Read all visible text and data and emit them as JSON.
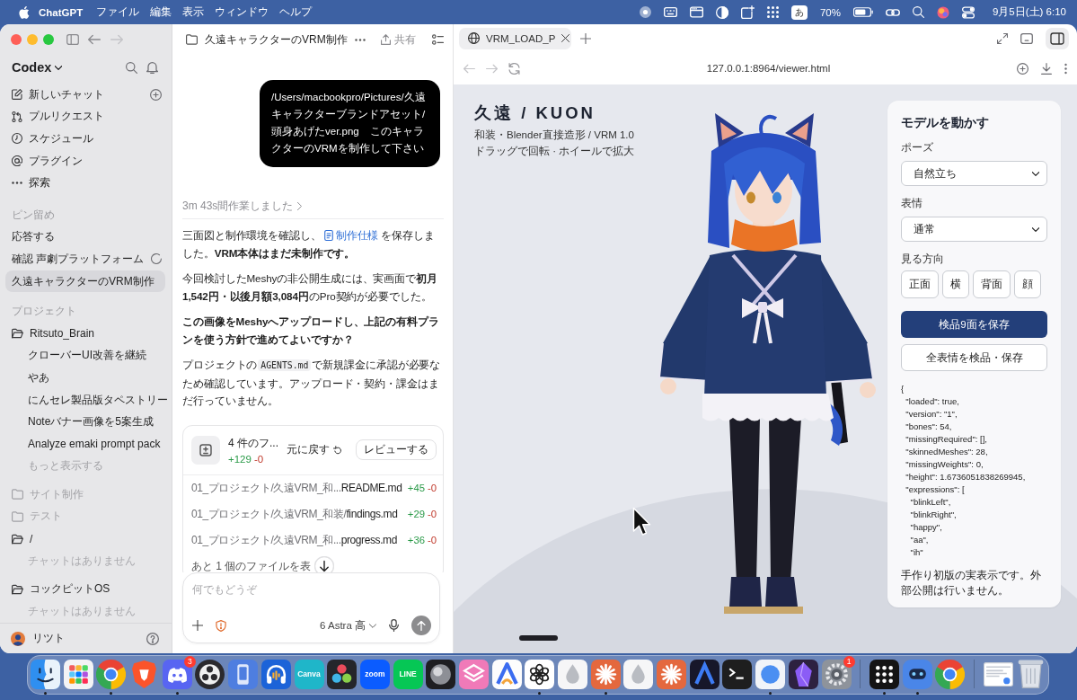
{
  "menu_bar": {
    "app_name": "ChatGPT",
    "menus": [
      "ファイル",
      "編集",
      "表示",
      "ウィンドウ",
      "ヘルプ"
    ],
    "input_mode": "あ",
    "battery": "70%",
    "clock": "9月5日(土) 6:10"
  },
  "sidebar": {
    "workspace": "Codex",
    "nav": [
      {
        "label": "新しいチャット",
        "kind": "new_chat"
      },
      {
        "label": "プルリクエスト",
        "kind": "pull_requests"
      },
      {
        "label": "スケジュール",
        "kind": "schedule"
      },
      {
        "label": "プラグイン",
        "kind": "plugins"
      },
      {
        "label": "探索",
        "kind": "explore"
      }
    ],
    "pinned_heading": "ピン留め",
    "pinned": [
      {
        "label": "応答する",
        "selected": false,
        "busy": false
      },
      {
        "label": "確認 声劇プラットフォーム",
        "selected": false,
        "busy": true
      },
      {
        "label": "久遠キャラクターのVRM制作",
        "selected": true,
        "busy": false
      }
    ],
    "projects_heading": "プロジェクト",
    "projects": [
      {
        "name": "Ritsuto_Brain",
        "expanded": true,
        "children": [
          {
            "label": "クローバーUI改善を継続",
            "kind": "chat"
          },
          {
            "label": "やあ",
            "kind": "chat"
          },
          {
            "label": "にんセレ製品版タペストリー",
            "kind": "chat"
          },
          {
            "label": "Noteバナー画像を5案生成",
            "kind": "chat"
          },
          {
            "label": "Analyze emaki prompt pack",
            "kind": "chat"
          },
          {
            "label": "もっと表示する",
            "kind": "more"
          }
        ]
      },
      {
        "name": "サイト制作",
        "expanded": false
      },
      {
        "name": "テスト",
        "expanded": false
      },
      {
        "name": "/",
        "expanded": true,
        "children": [
          {
            "label": "チャットはありません",
            "kind": "empty"
          }
        ]
      },
      {
        "name": "コックピットOS",
        "expanded": true,
        "children": [
          {
            "label": "チャットはありません",
            "kind": "empty"
          }
        ]
      }
    ],
    "user": {
      "name": "リツト"
    }
  },
  "chat": {
    "title": "久遠キャラクターのVRM制作",
    "share_label": "共有",
    "user_message": "/Users/macbookpro/Pictures/久遠キャラクターブランドアセット/頭身あげたver.png　このキャラクターのVRMを制作して下さい",
    "work_summary": "3m 43s間作業しました",
    "blocks": [
      {
        "kind": "link",
        "before": "三面図と制作環境を確認し、",
        "link": "制作仕様",
        "after": "を保存しました。**VRM本体はまだ未制作です。**"
      },
      {
        "kind": "text",
        "text": "今回検討したMeshyの非公開生成には、実画面で**初月1,542円・以後月額3,084円**のPro契約が必要でした。"
      },
      {
        "kind": "strong",
        "text": "この画像をMeshyへアップロードし、上記の有料プランを使う方針で進めてよいですか？"
      },
      {
        "kind": "code",
        "before": "プロジェクトの",
        "code": "AGENTS.md",
        "after": "で新規課金に承認が必要なため確認しています。アップロード・契約・課金はまだ行っていません。"
      }
    ],
    "changes": {
      "title": "4 件のフ...",
      "added": "+129",
      "removed": "-0",
      "undo_label": "元に戻す",
      "review_label": "レビューする",
      "files": [
        {
          "dir": "01_プロジェクト/久遠VRM_和...",
          "file": "README.md",
          "added": "+45",
          "removed": "-0"
        },
        {
          "dir": "01_プロジェクト/久遠VRM_和装/",
          "file": "findings.md",
          "added": "+29",
          "removed": "-0"
        },
        {
          "dir": "01_プロジェクト/久遠VRM_和...",
          "file": "progress.md",
          "added": "+36",
          "removed": "-0"
        }
      ],
      "more_files": "あと 1 個のファイルを表"
    },
    "composer": {
      "placeholder": "何でもどうぞ",
      "model": "6 Astra 高"
    }
  },
  "browser": {
    "tab": {
      "title": "VRM_LOAD_P",
      "selected": true
    },
    "url": "127.0.0.1:8964/viewer.html",
    "page": {
      "title": "久遠 / KUON",
      "subtitle_lines": [
        "和装・Blender直接造形 / VRM 1.0",
        "ドラッグで回転 · ホイールで拡大"
      ],
      "panel": {
        "title": "モデルを動かす",
        "selects": [
          {
            "label": "ポーズ",
            "value": "自然立ち"
          },
          {
            "label": "表情",
            "value": "通常"
          }
        ],
        "view_heading": "見る方向",
        "views": [
          "正面",
          "横",
          "背面",
          "顔"
        ],
        "actions": [
          {
            "label": "検品9面を保存",
            "kind": "primary"
          },
          {
            "label": "全表情を検品・保存",
            "kind": "secondary"
          }
        ],
        "status_lines": [
          "{",
          "  \"loaded\": true,",
          "  \"version\": \"1\",",
          "  \"bones\": 54,",
          "  \"missingRequired\": [],",
          "  \"skinnedMeshes\": 28,",
          "  \"missingWeights\": 0,",
          "  \"height\": 1.6736051838269945,",
          "  \"expressions\": [",
          "    \"blinkLeft\",",
          "    \"blinkRight\",",
          "    \"happy\",",
          "    \"aa\",",
          "    \"ih\""
        ],
        "note": "手作り初版の実表示です。外部公開は行いません。"
      }
    }
  },
  "dock": {
    "groups": [
      [
        {
          "kind": "face",
          "running": true
        },
        {
          "kind": "grid",
          "running": false
        },
        {
          "kind": "ring",
          "running": true
        },
        {
          "kind": "shield",
          "running": false
        },
        {
          "kind": "gamepad",
          "running": true,
          "badge": "3"
        },
        {
          "kind": "disc",
          "running": false
        },
        {
          "kind": "phone",
          "running": false
        },
        {
          "kind": "headphones",
          "running": false
        },
        {
          "kind": "label",
          "label": "Canva",
          "color": "#1fb6c9",
          "running": false
        },
        {
          "kind": "circles",
          "running": false
        },
        {
          "kind": "label",
          "label": "zoom",
          "color": "#0b5cff",
          "running": false
        },
        {
          "kind": "label",
          "label": "LINE",
          "color": "#06c755",
          "running": false
        },
        {
          "kind": "sphere",
          "running": false
        },
        {
          "kind": "layers",
          "running": false
        },
        {
          "kind": "arch",
          "running": false
        },
        {
          "kind": "knot",
          "running": true
        },
        {
          "kind": "drop",
          "running": false
        },
        {
          "kind": "asterisk",
          "running": true
        },
        {
          "kind": "drop",
          "running": false
        },
        {
          "kind": "asterisk",
          "running": false
        },
        {
          "kind": "arch_dark",
          "running": false
        },
        {
          "kind": "terminal",
          "running": false
        },
        {
          "kind": "bubble",
          "running": true
        },
        {
          "kind": "crystal",
          "running": false
        },
        {
          "kind": "gear",
          "running": false,
          "badge": "1"
        }
      ],
      [
        {
          "kind": "dot_grid",
          "running": true
        },
        {
          "kind": "robot",
          "running": true
        },
        {
          "kind": "ring",
          "running": false
        }
      ],
      [
        {
          "kind": "thumbnail",
          "running": false
        },
        {
          "kind": "trash",
          "running": false
        }
      ]
    ]
  }
}
